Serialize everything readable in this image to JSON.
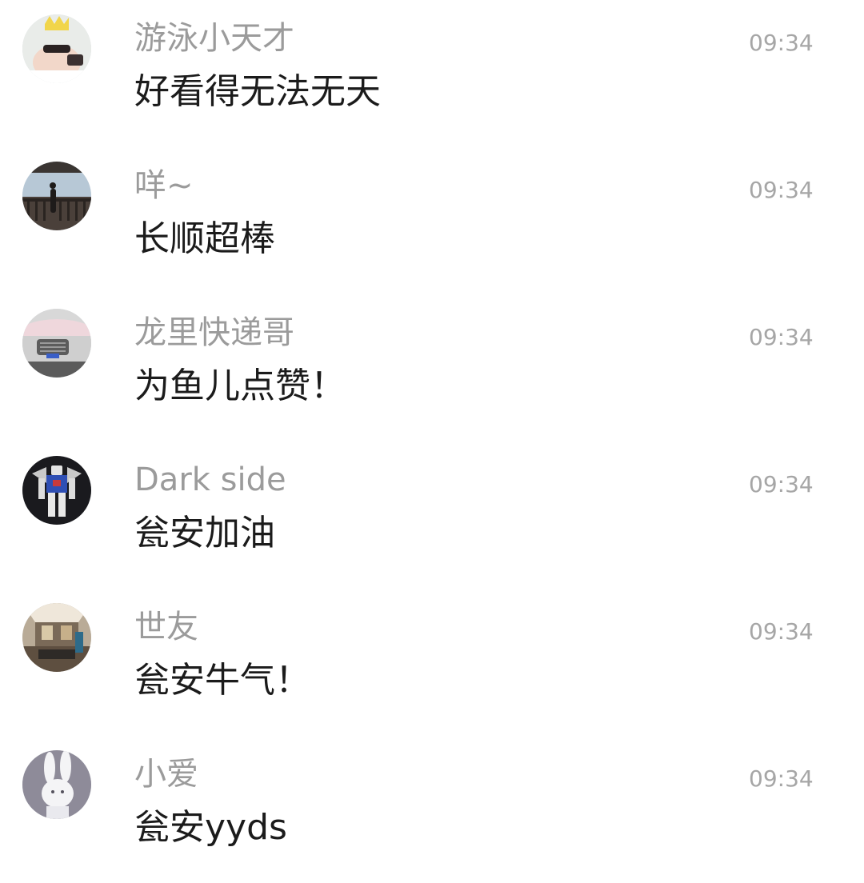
{
  "comments": [
    {
      "username": "游泳小天才",
      "time": "09:34",
      "message": "好看得无法无天",
      "avatar_icon": "avatar-person-crown"
    },
    {
      "username": "咩~",
      "time": "09:34",
      "message": "长顺超棒",
      "avatar_icon": "avatar-person-balcony"
    },
    {
      "username": "龙里快递哥",
      "time": "09:34",
      "message": "为鱼儿点赞！",
      "avatar_icon": "avatar-car"
    },
    {
      "username": "Dark side",
      "time": "09:34",
      "message": "瓮安加油",
      "avatar_icon": "avatar-robot"
    },
    {
      "username": "世友",
      "time": "09:34",
      "message": "瓮安牛气！",
      "avatar_icon": "avatar-room"
    },
    {
      "username": "小爱",
      "time": "09:34",
      "message": "瓮安yyds",
      "avatar_icon": "avatar-rabbit"
    }
  ]
}
